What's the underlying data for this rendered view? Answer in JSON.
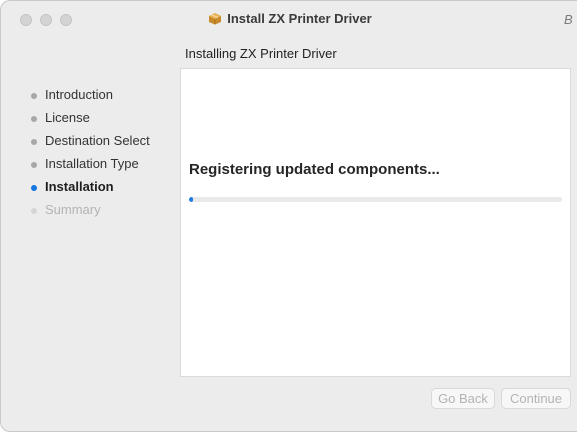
{
  "window": {
    "title": "Install ZX Printer Driver",
    "help_glyph": "B"
  },
  "header": {
    "subtitle": "Installing ZX Printer Driver"
  },
  "sidebar": {
    "steps": [
      {
        "label": "Introduction",
        "state": "done"
      },
      {
        "label": "License",
        "state": "done"
      },
      {
        "label": "Destination Select",
        "state": "done"
      },
      {
        "label": "Installation Type",
        "state": "done"
      },
      {
        "label": "Installation",
        "state": "active"
      },
      {
        "label": "Summary",
        "state": "future"
      }
    ]
  },
  "main": {
    "status_text": "Registering updated components...",
    "progress": 0.01
  },
  "footer": {
    "go_back_label": "Go Back",
    "continue_label": "Continue"
  },
  "colors": {
    "accent": "#1476e0",
    "window_bg": "#ececec",
    "panel_bg": "#ffffff",
    "disabled_text": "#b3b3b3"
  },
  "icons": {
    "title_icon": "package-icon"
  }
}
